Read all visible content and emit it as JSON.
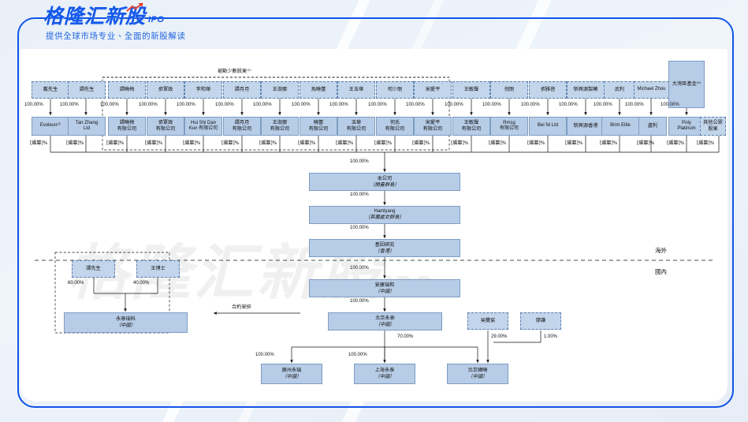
{
  "header": {
    "brand": "格隆汇新股",
    "brand_suffix": "IPO",
    "tagline": "提供全球市场专业、全面的新股解读",
    "accent_color": "#1358ea"
  },
  "watermark": {
    "text": "格隆汇新股",
    "suffix": "IPO"
  },
  "diagram": {
    "group_label": "被動少數股東⁽¹⁾",
    "contract_label": "合約安排",
    "overseas_label": "海外",
    "domestic_label": "國內",
    "pct_full": "100.00%",
    "redacted_pct": "[編纂]%",
    "tier1": [
      {
        "label": "戴先生",
        "pct": "100.00%"
      },
      {
        "label": "譚先生",
        "pct": "100.00%"
      },
      {
        "label": "譚曉梅",
        "pct": "100.00%"
      },
      {
        "label": "張軍政",
        "pct": "100.00%"
      },
      {
        "label": "李和華",
        "pct": "100.00%"
      },
      {
        "label": "譚月月",
        "pct": "100.00%"
      },
      {
        "label": "王淑娜",
        "pct": "100.00%"
      },
      {
        "label": "馬曉蕾",
        "pct": "100.00%"
      },
      {
        "label": "王玉華",
        "pct": "100.00%"
      },
      {
        "label": "何少剛",
        "pct": "100.00%"
      },
      {
        "label": "宋愛平",
        "pct": "100.00%"
      },
      {
        "label": "王敏聲",
        "pct": "100.00%"
      },
      {
        "label": "倪剛",
        "pct": "100.00%"
      },
      {
        "label": "張雅蓓",
        "pct": "100.00%"
      },
      {
        "label": "新興源製藥",
        "pct": "100.00%"
      },
      {
        "label": "武利",
        "pct": "100.00%"
      },
      {
        "label": "Michael Zhou",
        "pct": "100.00%"
      }
    ],
    "tier1_fund": {
      "label": "大灣區基金⁽⁴⁾",
      "pct": "100.00%"
    },
    "tier2": [
      {
        "label": "Evolevo⁽²⁾",
        "sub": "",
        "english": true,
        "redact": "[編纂]%"
      },
      {
        "label": "Tan Zhang",
        "sub": "Ltd",
        "english": true,
        "redact": "[編纂]%"
      },
      {
        "label": "譚曉梅",
        "sub": "有限公司",
        "english": false,
        "redact": "[編纂]%"
      },
      {
        "label": "張軍政",
        "sub": "有限公司",
        "english": false,
        "redact": "[編纂]%"
      },
      {
        "label": "Hui Shi Dan",
        "sub": "Kun 有限公司",
        "english": true,
        "redact": "[編纂]%"
      },
      {
        "label": "譚月月",
        "sub": "有限公司",
        "english": false,
        "redact": "[編纂]%"
      },
      {
        "label": "王淑娜",
        "sub": "有限公司",
        "english": false,
        "redact": "[編纂]%"
      },
      {
        "label": "曉蕾",
        "sub": "有限公司",
        "english": false,
        "redact": "[編纂]%"
      },
      {
        "label": "玉華",
        "sub": "有限公司",
        "english": false,
        "redact": "[編纂]%"
      },
      {
        "label": "何氏",
        "sub": "有限公司",
        "english": false,
        "redact": "[編纂]%"
      },
      {
        "label": "宋愛平",
        "sub": "有限公司",
        "english": false,
        "redact": "[編纂]%"
      },
      {
        "label": "王敏聲",
        "sub": "有限公司",
        "english": false,
        "redact": "[編纂]%"
      },
      {
        "label": "Rmsg",
        "sub": "有限公司",
        "english": true,
        "redact": "[編纂]%"
      },
      {
        "label": "Bei Ni Ltd",
        "sub": "",
        "english": true,
        "redact": "[編纂]%"
      },
      {
        "label": "新興源香港",
        "sub": "",
        "english": false,
        "redact": "[編纂]%"
      },
      {
        "label": "Brim Elite",
        "sub": "",
        "english": true,
        "redact": "[編纂]%"
      },
      {
        "label": "盧利",
        "sub": "",
        "english": false,
        "redact": "[編纂]%"
      },
      {
        "label": "Poly",
        "sub": "Platinum",
        "english": true,
        "redact": "[編纂]%"
      },
      {
        "label": "其他公眾股東",
        "sub": "",
        "english": false,
        "redact": "[編纂]%"
      }
    ],
    "spine": [
      {
        "label": "本公司",
        "sub": "（開曼群島）",
        "in_pct": "100.00%"
      },
      {
        "label": "Hamlyang",
        "sub": "（英屬處女群島）",
        "in_pct": "100.00%",
        "english": true
      },
      {
        "label": "基因研究",
        "sub": "（香港）",
        "in_pct": "100.00%"
      },
      {
        "label": "安康瑞和",
        "sub": "（中國）",
        "in_pct": "100.00%"
      },
      {
        "label": "北京永泰",
        "sub": "（中國）",
        "in_pct": "100.00%"
      }
    ],
    "vie": {
      "owners": [
        {
          "label": "譚先生",
          "pct": "60.00%"
        },
        {
          "label": "王博士",
          "pct": "40.00%"
        }
      ],
      "entity": {
        "label": "永泰瑞科",
        "sub": "（中國）"
      }
    },
    "minority": [
      {
        "label": "吳雙宸",
        "pct": "29.00%"
      },
      {
        "label": "廖謙",
        "pct": "1.00%"
      }
    ],
    "bottom": [
      {
        "label": "廣州永瑞",
        "sub": "（中國）",
        "pct": "100.00%"
      },
      {
        "label": "上海永泰",
        "sub": "（中國）",
        "pct": "100.00%"
      },
      {
        "label": "北京緯曉",
        "sub": "（中國）",
        "pct": "70.00%"
      }
    ]
  }
}
